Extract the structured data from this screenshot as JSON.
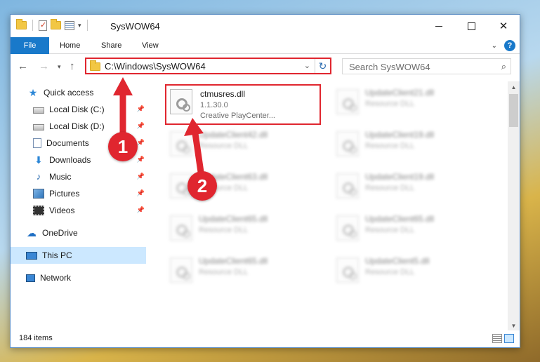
{
  "window": {
    "title": "SysWOW64"
  },
  "ribbon": {
    "tabs": [
      "File",
      "Home",
      "Share",
      "View"
    ]
  },
  "address": {
    "path": "C:\\Windows\\SysWOW64"
  },
  "search": {
    "placeholder": "Search SysWOW64"
  },
  "nav": {
    "items": [
      {
        "label": "Quick access",
        "icon": "star-icon",
        "pinned": false
      },
      {
        "label": "Local Disk (C:)",
        "icon": "disk-icon",
        "pinned": true
      },
      {
        "label": "Local Disk (D:)",
        "icon": "disk-icon",
        "pinned": true
      },
      {
        "label": "Documents",
        "icon": "documents-icon",
        "pinned": true
      },
      {
        "label": "Downloads",
        "icon": "download-icon",
        "pinned": true
      },
      {
        "label": "Music",
        "icon": "music-icon",
        "pinned": true
      },
      {
        "label": "Pictures",
        "icon": "pictures-icon",
        "pinned": true
      },
      {
        "label": "Videos",
        "icon": "videos-icon",
        "pinned": true
      },
      {
        "label": "OneDrive",
        "icon": "onedrive-icon",
        "pinned": false
      },
      {
        "label": "This PC",
        "icon": "pc-icon",
        "pinned": false
      },
      {
        "label": "Network",
        "icon": "network-icon",
        "pinned": false
      }
    ]
  },
  "files": {
    "highlighted": {
      "name": "ctmusres.dll",
      "version": "1.1.30.0",
      "description": "Creative PlayCenter..."
    },
    "blurred_type": "Resource DLL",
    "left": [
      "UpdateClient42.dll",
      "UpdateClient63.dll",
      "UpdateClient65.dll",
      "UpdateClient65.dll"
    ],
    "right": [
      "UpdateClient21.dll",
      "UpdateClient19.dll",
      "UpdateClient19.dll",
      "UpdateClient65.dll",
      "UpdateClient5.dll"
    ]
  },
  "status": {
    "item_count": "184 items"
  },
  "annotations": {
    "step1": "1",
    "step2": "2"
  },
  "colors": {
    "accent": "#1979ca",
    "highlight": "#e0262f",
    "selected": "#cce8ff"
  }
}
